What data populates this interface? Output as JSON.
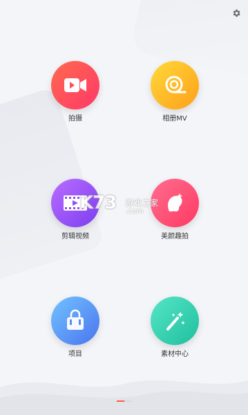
{
  "toolbar": {
    "settings_icon": "gear-icon"
  },
  "menu": {
    "items": [
      {
        "label": "拍摄",
        "icon": "video-camera-icon",
        "gradient": [
          "#ff5f4f",
          "#ff3b6b"
        ]
      },
      {
        "label": "相册MV",
        "icon": "film-reel-icon",
        "gradient": [
          "#ffd23a",
          "#ff9a1e"
        ]
      },
      {
        "label": "剪辑视频",
        "icon": "film-strip-icon",
        "gradient": [
          "#b36bff",
          "#7b3ff0"
        ]
      },
      {
        "label": "美颜趣拍",
        "icon": "face-beauty-icon",
        "gradient": [
          "#ff6a8e",
          "#ff3b63"
        ]
      },
      {
        "label": "项目",
        "icon": "bag-icon",
        "gradient": [
          "#6fb7ff",
          "#4c79f0"
        ]
      },
      {
        "label": "素材中心",
        "icon": "magic-wand-icon",
        "gradient": [
          "#4ee3c0",
          "#1fbfa0"
        ]
      }
    ]
  },
  "watermark": {
    "brand": "K73",
    "site_cn": "游戏之家",
    "site_domain": ".com"
  },
  "pager": {
    "active": "#ff5a3c",
    "inactive": "#d8d8d8"
  }
}
